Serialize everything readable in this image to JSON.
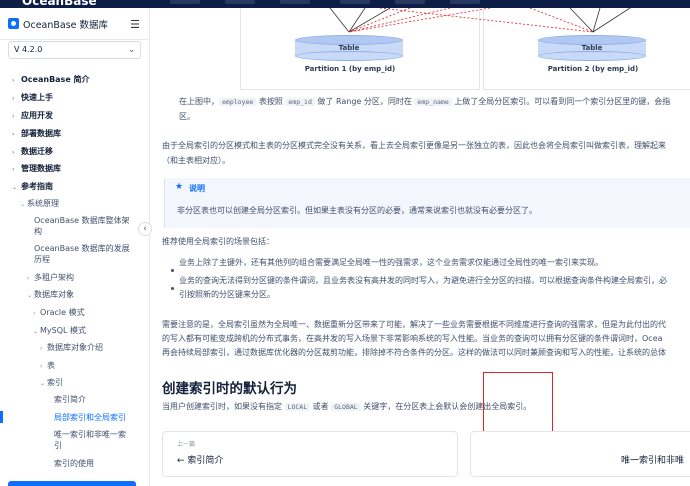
{
  "app": {
    "brand": "OceanBase",
    "sidebar_title": "OceanBase 数据库",
    "menu_icon": "hamburger-icon",
    "version": "V 4.2.0"
  },
  "sidebar": {
    "items": [
      {
        "label": "OceanBase 简介"
      },
      {
        "label": "快速上手"
      },
      {
        "label": "应用开发"
      },
      {
        "label": "部署数据库"
      },
      {
        "label": "数据迁移"
      },
      {
        "label": "管理数据库"
      },
      {
        "label": "参考指南"
      },
      {
        "label": "系统原理"
      },
      {
        "label": "OceanBase 数据库整体架构"
      },
      {
        "label": "OceanBase 数据库的发展历程"
      },
      {
        "label": "多租户架构"
      },
      {
        "label": "数据库对象"
      },
      {
        "label": "Oracle 模式"
      },
      {
        "label": "MySQL 模式"
      },
      {
        "label": "数据库对象介绍"
      },
      {
        "label": "表"
      },
      {
        "label": "索引"
      },
      {
        "label": "索引简介"
      },
      {
        "label": "局部索引和全局索引"
      },
      {
        "label": "唯一索引和非唯一索引"
      },
      {
        "label": "索引的使用"
      }
    ],
    "arch_line1": "OceanBase 数据库整体架",
    "arch_line2": "构",
    "hist_line1": "OceanBase 数据库的发展",
    "hist_line2": "历程",
    "uniq_line1": "唯一索引和非唯一索",
    "uniq_line2": "引"
  },
  "diagram": {
    "table_label": "Table",
    "partition1": "Partition 1 (by emp_id)",
    "partition2": "Partition 2 (by emp_id)"
  },
  "article": {
    "p1_a": "在上图中，",
    "p1_code1": "employee",
    "p1_b": " 表按照 ",
    "p1_code2": "emp_id",
    "p1_c": " 做了 Range 分区，同时在 ",
    "p1_code3": "emp_name",
    "p1_d": " 上做了全局分区索引。可以看到同一个索引分区里的键，会指",
    "p1_end": "区。",
    "p2_line1": "由于全局索引的分区模式和主表的分区模式完全没有关系，看上去全局索引更像是另一张独立的表，因此也会将全局索引叫做索引表，理解起来",
    "p2_line2": "（和主表相对应）。",
    "note_title": "说明",
    "note_icon": "info-star-icon",
    "note_body": "非分区表也可以创建全局分区索引。但如果主表没有分区的必要，通常来说索引也就没有必要分区了。",
    "scenarios_intro": "推荐使用全局索引的场景包括：",
    "b1": "业务上除了主键外，还有其他列的组合需要满足全局唯一性的强需求，这个业务需求仅能通过全局性的唯一索引来实现。",
    "b2_line1": "业务的查询无法得到分区键的条件谓词，且业务表没有高并发的同时写入，为避免进行全分区的扫描，可以根据查询条件构建全局索引，必",
    "b2_line2": "引按照新的分区键来分区。",
    "p3_line1": "需要注意的是，全局索引虽然为全局唯一、数据重新分区带来了可能，解决了一些业务需要根据不同维度进行查询的强需求，但是为此付出的代",
    "p3_line2": "的写入都有可能变成跨机的分布式事务，在高并发的写入场景下非常影响系统的写入性能。当业务的查询可以拥有分区键的条件谓词时，Ocea",
    "p3_line3": "再会持续局部索引，通过数据库优化器的分区裁剪功能，排除掉不符合条件的分区。这样的做法可以同时兼顾查询和写入的性能，让系统的总体",
    "h2": "创建索引时的默认行为",
    "p4_a": "当用户创建索引时，如果没有指定 ",
    "p4_code1": "LOCAL",
    "p4_b": " 或者 ",
    "p4_code2": "GLOBAL",
    "p4_c": " 关键字，在分区表上会默认会创建出全局索引。"
  },
  "pager": {
    "prev_small": "上一篇",
    "prev_title": "索引简介",
    "prev_icon": "arrow-left-icon",
    "next_title": "唯一索引和非唯"
  },
  "colors": {
    "accent": "#0d6eff",
    "annotation": "#e0242b"
  }
}
